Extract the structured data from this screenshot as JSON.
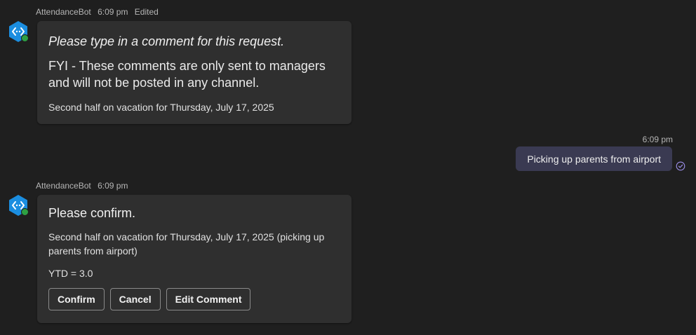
{
  "messages": [
    {
      "sender": "AttendanceBot",
      "time": "6:09 pm",
      "edited_label": "Edited",
      "avatar_icon": "bot-code-hex-icon",
      "card": {
        "heading": "Please type in a comment for this request.",
        "note": "FYI - These comments are only sent to managers and will not be posted in any channel.",
        "detail": "Second half on vacation for Thursday, July 17, 2025"
      }
    },
    {
      "sender": "AttendanceBot",
      "time": "6:09 pm",
      "avatar_icon": "bot-code-hex-icon",
      "card": {
        "title": "Please confirm.",
        "detail": "Second half on vacation for Thursday, July 17, 2025 (picking up parents from airport)",
        "ytd": "YTD = 3.0",
        "buttons": [
          "Confirm",
          "Cancel",
          "Edit Comment"
        ]
      }
    }
  ],
  "outgoing": {
    "time": "6:09 pm",
    "text": "Picking up parents from airport",
    "status_icon": "read-receipt-check-icon"
  },
  "colors": {
    "background": "#1f1f1f",
    "card": "#2f2f2f",
    "outgoing_bubble": "#3a3a52",
    "avatar_blue": "#1b8ee0",
    "presence_green": "#2ea043",
    "read_receipt": "#9b8ee8"
  }
}
